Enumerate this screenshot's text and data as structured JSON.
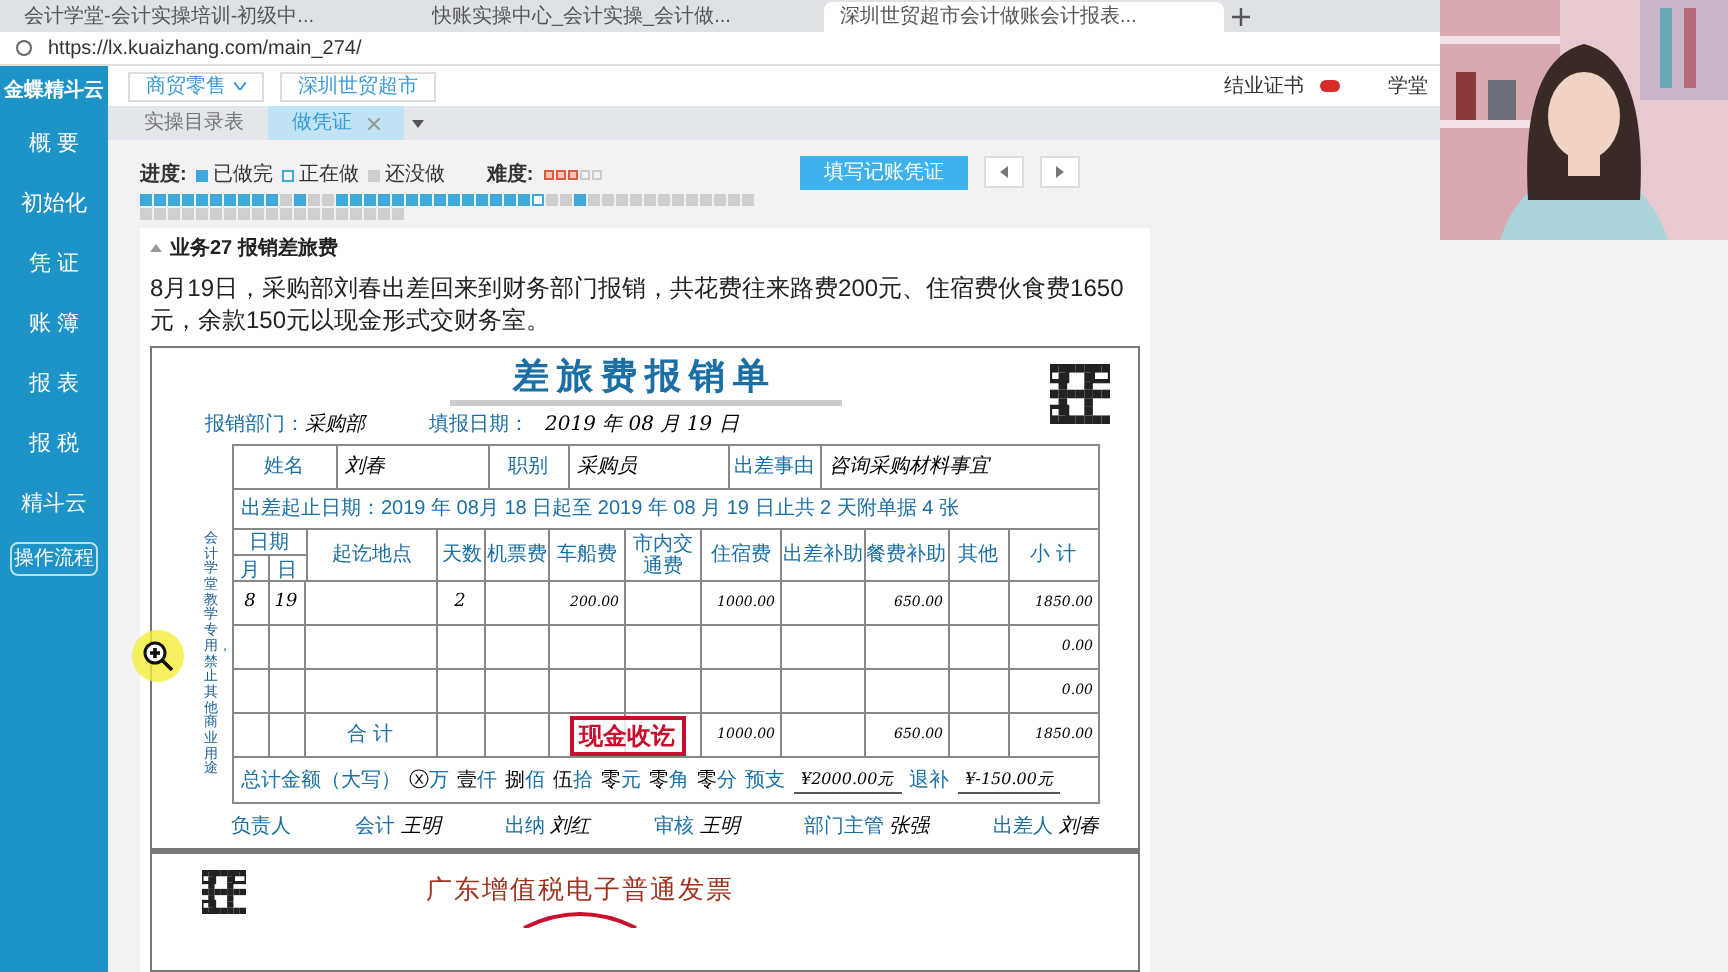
{
  "browser": {
    "tabs": [
      {
        "title": "会计学堂-会计实操培训-初级中...",
        "selected": false
      },
      {
        "title": "快账实操中心_会计实操_会计做...",
        "selected": false
      },
      {
        "title": "深圳世贸超市会计做账会计报表...",
        "selected": true
      }
    ],
    "url": "https://lx.kuaizhang.com/main_274/"
  },
  "sidebar": {
    "logo": "金蝶精斗云",
    "items": [
      {
        "label": "概 要"
      },
      {
        "label": "初始化"
      },
      {
        "label": "凭 证"
      },
      {
        "label": "账 簿"
      },
      {
        "label": "报 表"
      },
      {
        "label": "报 税"
      },
      {
        "label": "精斗云"
      }
    ],
    "button": "操作流程"
  },
  "topbar": {
    "industry": "商贸零售",
    "company": "深圳世贸超市",
    "certificate": "结业证书",
    "user": "学堂"
  },
  "page_tabs": [
    {
      "label": "实操目录表",
      "selected": false,
      "closable": false
    },
    {
      "label": "做凭证",
      "selected": true,
      "closable": true
    }
  ],
  "progress": {
    "label": "进度:",
    "legend": [
      {
        "kind": "done",
        "label": "已做完"
      },
      {
        "kind": "current",
        "label": "正在做"
      },
      {
        "kind": "todo",
        "label": "还没做"
      }
    ],
    "difficulty_label": "难度:",
    "stars": 3,
    "cells": [
      {
        "done": true,
        "current": false
      },
      {
        "done": true,
        "current": false
      },
      {
        "done": true,
        "current": false
      },
      {
        "done": true,
        "current": false
      },
      {
        "done": true,
        "current": false
      },
      {
        "done": true,
        "current": false
      },
      {
        "done": true,
        "current": false
      },
      {
        "done": true,
        "current": false
      },
      {
        "done": true,
        "current": false
      },
      {
        "done": true,
        "current": false
      },
      {
        "done": false,
        "current": false
      },
      {
        "done": true,
        "current": false
      },
      {
        "done": false,
        "current": false
      },
      {
        "done": false,
        "current": false
      },
      {
        "done": true,
        "current": false
      },
      {
        "done": true,
        "current": false
      },
      {
        "done": true,
        "current": false
      },
      {
        "done": true,
        "current": false
      },
      {
        "done": true,
        "current": false
      },
      {
        "done": true,
        "current": false
      },
      {
        "done": true,
        "current": false
      },
      {
        "done": true,
        "current": false
      },
      {
        "done": true,
        "current": false
      },
      {
        "done": true,
        "current": false
      },
      {
        "done": true,
        "current": false
      },
      {
        "done": true,
        "current": false
      },
      {
        "done": true,
        "current": false
      },
      {
        "done": true,
        "current": false
      },
      {
        "done": false,
        "current": true
      },
      {
        "done": false,
        "current": false
      },
      {
        "done": false,
        "current": false
      },
      {
        "done": true,
        "current": false
      },
      {
        "done": false,
        "current": false
      },
      {
        "done": false,
        "current": false
      },
      {
        "done": false,
        "current": false
      },
      {
        "done": false,
        "current": false
      },
      {
        "done": false,
        "current": false
      },
      {
        "done": false,
        "current": false
      },
      {
        "done": false,
        "current": false
      },
      {
        "done": false,
        "current": false
      },
      {
        "done": false,
        "current": false
      },
      {
        "done": false,
        "current": false
      },
      {
        "done": false,
        "current": false
      },
      {
        "done": false,
        "current": false
      },
      {
        "done": false,
        "current": false
      },
      {
        "done": false,
        "current": false
      },
      {
        "done": false,
        "current": false
      },
      {
        "done": false,
        "current": false
      },
      {
        "done": false,
        "current": false
      },
      {
        "done": false,
        "current": false
      },
      {
        "done": false,
        "current": false
      },
      {
        "done": false,
        "current": false
      },
      {
        "done": false,
        "current": false
      },
      {
        "done": false,
        "current": false
      },
      {
        "done": false,
        "current": false
      },
      {
        "done": false,
        "current": false
      },
      {
        "done": false,
        "current": false
      },
      {
        "done": false,
        "current": false
      },
      {
        "done": false,
        "current": false
      },
      {
        "done": false,
        "current": false
      },
      {
        "done": false,
        "current": false
      },
      {
        "done": false,
        "current": false
      },
      {
        "done": false,
        "current": false
      }
    ]
  },
  "fill_button": "填写记账凭证",
  "task": {
    "title": "业务27 报销差旅费",
    "description": "8月19日，采购部刘春出差回来到财务部门报销，共花费往来路费200元、住宿费伙食费1650元，余款150元以现金形式交财务室。"
  },
  "form": {
    "title": "差旅费报销单",
    "dept_label": "报销部门：",
    "dept": "采购部",
    "date_label": "填报日期：",
    "date": "2019 年 08 月 19 日",
    "name_label": "姓名",
    "name": "刘春",
    "position_label": "职别",
    "position": "采购员",
    "reason_label": "出差事由",
    "reason": "咨询采购材料事宜",
    "period": "出差起止日期：2019 年 08月 18 日起至 2019 年 08 月 19 日止共 2 天附单据 4 张",
    "side_note": "会计学堂教学专用，禁止其他商业用途",
    "date_header": "日期",
    "columns": [
      "月",
      "日",
      "起讫地点",
      "天数",
      "机票费",
      "车船费",
      "市内交通费",
      "住宿费",
      "出差补助",
      "餐费补助",
      "其他",
      "小 计"
    ],
    "rows": [
      {
        "cells": [
          "8",
          "19",
          "",
          "2",
          "",
          "200.00",
          "",
          "1000.00",
          "",
          "650.00",
          "",
          "1850.00"
        ]
      },
      {
        "cells": [
          "",
          "",
          "",
          "",
          "",
          "",
          "",
          "",
          "",
          "",
          "",
          "0.00"
        ]
      },
      {
        "cells": [
          "",
          "",
          "",
          "",
          "",
          "",
          "",
          "",
          "",
          "",
          "",
          "0.00"
        ]
      }
    ],
    "total": {
      "label": "合 计",
      "cells": [
        "",
        "",
        "",
        "",
        "1000.00",
        "",
        "650.00",
        "",
        "1850.00"
      ]
    },
    "stamp": "现金收讫",
    "amount_label": "总计金额（大写）",
    "amount": [
      {
        "digit": "ⓧ",
        "unit": "万"
      },
      {
        "digit": "壹",
        "unit": "仟"
      },
      {
        "digit": "捌",
        "unit": "佰"
      },
      {
        "digit": "伍",
        "unit": "拾"
      },
      {
        "digit": "零",
        "unit": "元"
      },
      {
        "digit": "零",
        "unit": "角"
      },
      {
        "digit": "零",
        "unit": "分"
      }
    ],
    "advance_label": "预支",
    "advance": "¥2000.00元",
    "refund_label": "退补",
    "refund": "¥-150.00元",
    "signers": [
      {
        "role": "负责人"
      },
      {
        "role": "会计",
        "name": "王明"
      },
      {
        "role": "出纳",
        "name": "刘红"
      },
      {
        "role": "审核",
        "name": "王明"
      },
      {
        "role": "部门主管",
        "name": "张强"
      },
      {
        "role": "出差人",
        "name": "刘春"
      }
    ]
  },
  "invoice": {
    "title": "广东增值税电子普通发票"
  }
}
